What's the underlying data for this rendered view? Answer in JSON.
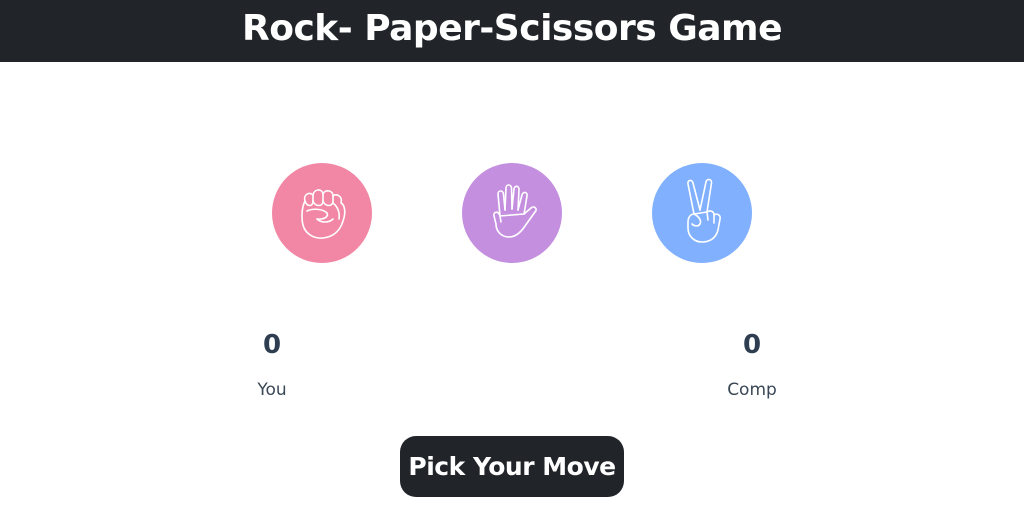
{
  "header": {
    "title": "Rock- Paper-Scissors Game"
  },
  "choices": [
    {
      "id": "rock",
      "icon": "rock-fist-icon",
      "color": "#f287a5"
    },
    {
      "id": "paper",
      "icon": "paper-hand-icon",
      "color": "#c58fdf"
    },
    {
      "id": "scissors",
      "icon": "scissors-peace-hand-icon",
      "color": "#80b0fe"
    }
  ],
  "scoreboard": {
    "you": {
      "score": "0",
      "label": "You"
    },
    "comp": {
      "score": "0",
      "label": "Comp"
    }
  },
  "action": {
    "pick_label": "Pick Your Move"
  },
  "colors": {
    "header_bg": "#212529",
    "button_bg": "#212529",
    "score_text": "#2e3e50"
  }
}
